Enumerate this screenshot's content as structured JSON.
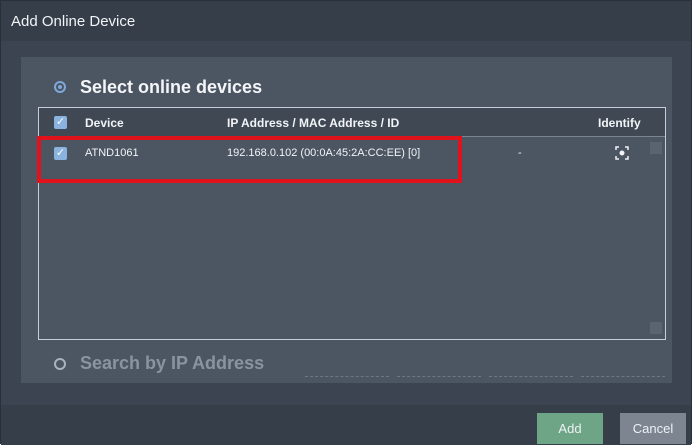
{
  "window": {
    "title": "Add Online Device"
  },
  "select_online": {
    "label": "Select online devices",
    "selected": true
  },
  "search_ip": {
    "label": "Search by IP Address",
    "selected": false
  },
  "table": {
    "columns": [
      "Device",
      "IP Address / MAC Address / ID",
      "",
      "Identify"
    ],
    "rows": [
      {
        "checked": true,
        "device": "ATND1061",
        "address": "192.168.0.102 (00:0A:45:2A:CC:EE)  [0]",
        "extra": "-",
        "identify_icon": "identify-icon"
      }
    ]
  },
  "buttons": {
    "add": "Add",
    "cancel": "Cancel"
  },
  "colors": {
    "highlight": "#e0121c",
    "add_button": "#6ea587",
    "accent": "#8ab3df"
  }
}
